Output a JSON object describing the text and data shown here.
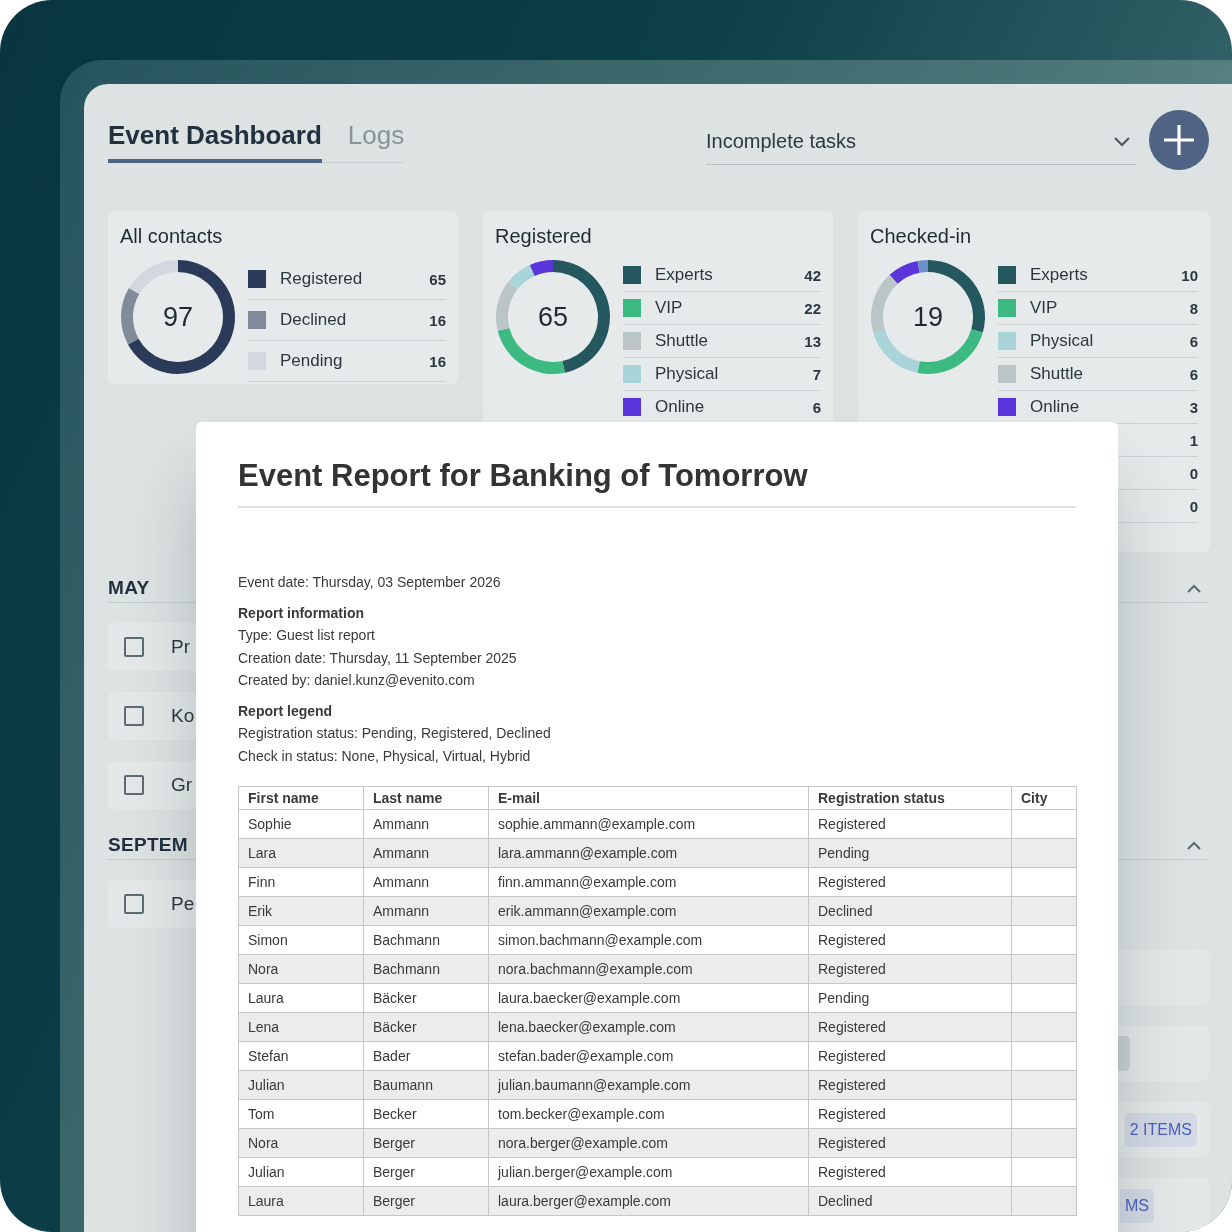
{
  "tabs": [
    {
      "label": "Event Dashboard",
      "selected": true
    },
    {
      "label": "Logs",
      "selected": false
    }
  ],
  "task_filter": {
    "value": "Incomplete tasks"
  },
  "stat_cards": [
    {
      "title": "All contacts",
      "total": "97",
      "legend": [
        {
          "label": "Registered",
          "count": "65",
          "color": "#2a3a58"
        },
        {
          "label": "Declined",
          "count": "16",
          "color": "#828b9a"
        },
        {
          "label": "Pending",
          "count": "16",
          "color": "#d3d8e0"
        }
      ],
      "chart_data": {
        "type": "donut",
        "values": [
          67.02,
          16.49,
          16.49
        ]
      }
    },
    {
      "title": "Registered",
      "total": "65",
      "legend": [
        {
          "label": "Experts",
          "count": "42",
          "color": "#24585e"
        },
        {
          "label": "VIP",
          "count": "22",
          "color": "#3dba82"
        },
        {
          "label": "Shuttle",
          "count": "13",
          "color": "#bcc5c5"
        },
        {
          "label": "Physical",
          "count": "7",
          "color": "#a8d4da"
        },
        {
          "label": "Online",
          "count": "6",
          "color": "#5a35dc"
        }
      ],
      "chart_data": {
        "type": "donut",
        "values": [
          46.67,
          24.44,
          14.44,
          7.78,
          6.67
        ]
      }
    },
    {
      "title": "Checked-in",
      "total": "19",
      "legend": [
        {
          "label": "Experts",
          "count": "10",
          "color": "#24585e"
        },
        {
          "label": "VIP",
          "count": "8",
          "color": "#3dba82"
        },
        {
          "label": "Physical",
          "count": "6",
          "color": "#a8d4da"
        },
        {
          "label": "Shuttle",
          "count": "6",
          "color": "#bcc5c5"
        },
        {
          "label": "Online",
          "count": "3",
          "color": "#5a35dc"
        },
        {
          "count": "1",
          "color": "#6b8fc9"
        },
        {
          "count": "0"
        },
        {
          "count": "0"
        }
      ],
      "chart_data": {
        "type": "donut",
        "values": [
          29.41,
          23.53,
          17.65,
          17.65,
          8.82,
          2.94,
          0,
          0
        ]
      }
    }
  ],
  "sections": [
    {
      "heading": "MAY",
      "expanded": true,
      "tasks": [
        {
          "title": "Pr",
          "checked": false
        },
        {
          "title": "Ko",
          "checked": false
        },
        {
          "title": "Gr",
          "checked": false
        }
      ]
    },
    {
      "heading": "SEPTEM",
      "expanded": true,
      "tasks": [
        {
          "title": "Pe",
          "checked": false
        }
      ],
      "side_rows": [
        {
          "kind": "plain"
        },
        {
          "kind": "chip"
        },
        {
          "kind": "badge",
          "badge": "2 ITEMS"
        },
        {
          "kind": "tag",
          "badge": "MS"
        }
      ]
    }
  ],
  "report": {
    "title": "Event Report for Banking of Tomorrow",
    "event_date": "Event date: Thursday, 03 September 2026",
    "blocks": [
      {
        "heading": "Report information",
        "lines": [
          "Type: Guest list report",
          "Creation date: Thursday, 11 September 2025",
          "Created by: daniel.kunz@evenito.com"
        ]
      },
      {
        "heading": "Report legend",
        "lines": [
          "Registration status: Pending, Registered, Declined",
          "Check in status: None, Physical, Virtual, Hybrid"
        ]
      }
    ],
    "table": {
      "columns": [
        "First name",
        "Last name",
        "E-mail",
        "Registration status",
        "City"
      ],
      "rows": [
        [
          "Sophie",
          "Ammann",
          "sophie.ammann@example.com",
          "Registered"
        ],
        [
          "Lara",
          "Ammann",
          "lara.ammann@example.com",
          "Pending"
        ],
        [
          "Finn",
          "Ammann",
          "finn.ammann@example.com",
          "Registered"
        ],
        [
          "Erik",
          "Ammann",
          "erik.ammann@example.com",
          "Declined"
        ],
        [
          "Simon",
          "Bachmann",
          "simon.bachmann@example.com",
          "Registered"
        ],
        [
          "Nora",
          "Bachmann",
          "nora.bachmann@example.com",
          "Registered"
        ],
        [
          "Laura",
          "Bäcker",
          "laura.baecker@example.com",
          "Pending"
        ],
        [
          "Lena",
          "Bäcker",
          "lena.baecker@example.com",
          "Registered"
        ],
        [
          "Stefan",
          "Bader",
          "stefan.bader@example.com",
          "Registered"
        ],
        [
          "Julian",
          "Baumann",
          "julian.baumann@example.com",
          "Registered"
        ],
        [
          "Tom",
          "Becker",
          "tom.becker@example.com",
          "Registered"
        ],
        [
          "Nora",
          "Berger",
          "nora.berger@example.com",
          "Registered"
        ],
        [
          "Julian",
          "Berger",
          "julian.berger@example.com",
          "Registered"
        ],
        [
          "Laura",
          "Berger",
          "laura.berger@example.com",
          "Declined"
        ]
      ]
    }
  }
}
